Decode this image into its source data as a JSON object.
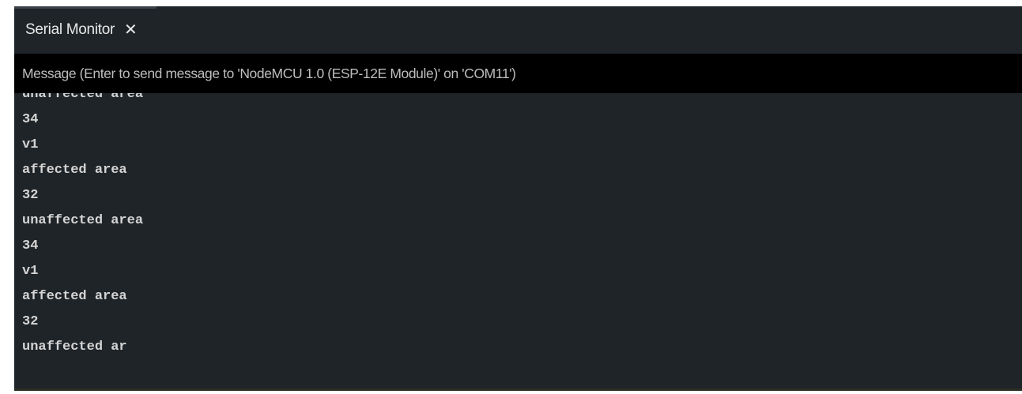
{
  "tab": {
    "label": "Serial Monitor",
    "close_icon": "close-icon",
    "close_glyph": "✕"
  },
  "message": {
    "placeholder": "Message (Enter to send message to 'NodeMCU 1.0 (ESP-12E Module)' on 'COM11')"
  },
  "output": {
    "lines": [
      "unaffected area",
      "34",
      "v1",
      "affected area",
      "32",
      "unaffected area",
      "34",
      "v1",
      "affected area",
      "32",
      "unaffected ar"
    ]
  },
  "colors": {
    "panel_background": "#1f2428",
    "message_bar_background": "#000000",
    "text": "#d4d4d4"
  }
}
